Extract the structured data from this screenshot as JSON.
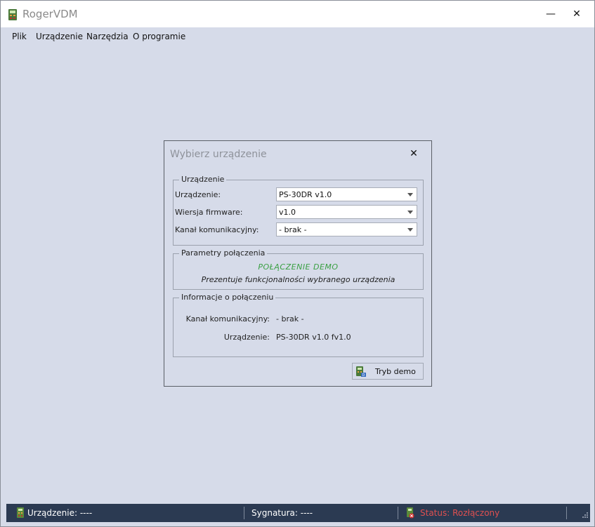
{
  "window": {
    "title": "RogerVDM",
    "minimize_glyph": "—",
    "close_glyph": "✕"
  },
  "menu": {
    "items": [
      {
        "label": "Plik"
      },
      {
        "label": "Urządzenie"
      },
      {
        "label": "Narzędzia"
      },
      {
        "label": "O programie"
      }
    ]
  },
  "dialog": {
    "title": "Wybierz urządzenie",
    "close_glyph": "✕",
    "device_group": {
      "legend": "Urządzenie",
      "device_label": "Urządzenie:",
      "device_value": "PS-30DR v1.0",
      "firmware_label": "Wiersja firmware:",
      "firmware_value": "v1.0",
      "channel_label": "Kanał komunikacyjny:",
      "channel_value": "- brak -"
    },
    "params_group": {
      "legend": "Parametry połączenia",
      "demo_heading": "POŁĄCZENIE DEMO",
      "demo_description": "Prezentuje funkcjonalności wybranego urządzenia"
    },
    "info_group": {
      "legend": "Informacje o połączeniu",
      "channel_label": "Kanał komunikacyjny:",
      "channel_value": "- brak -",
      "device_label": "Urządzenie:",
      "device_value": "PS-30DR v1.0 fv1.0"
    },
    "demo_button_label": "Tryb demo"
  },
  "statusbar": {
    "device_text": "Urządzenie: ----",
    "signature_text": "Sygnatura: ----",
    "status_text": "Status: Rozłączony"
  },
  "colors": {
    "background": "#d6dbe9",
    "statusbar": "#2b3a52",
    "demo_green": "#3aa043",
    "status_red": "#e05050"
  }
}
